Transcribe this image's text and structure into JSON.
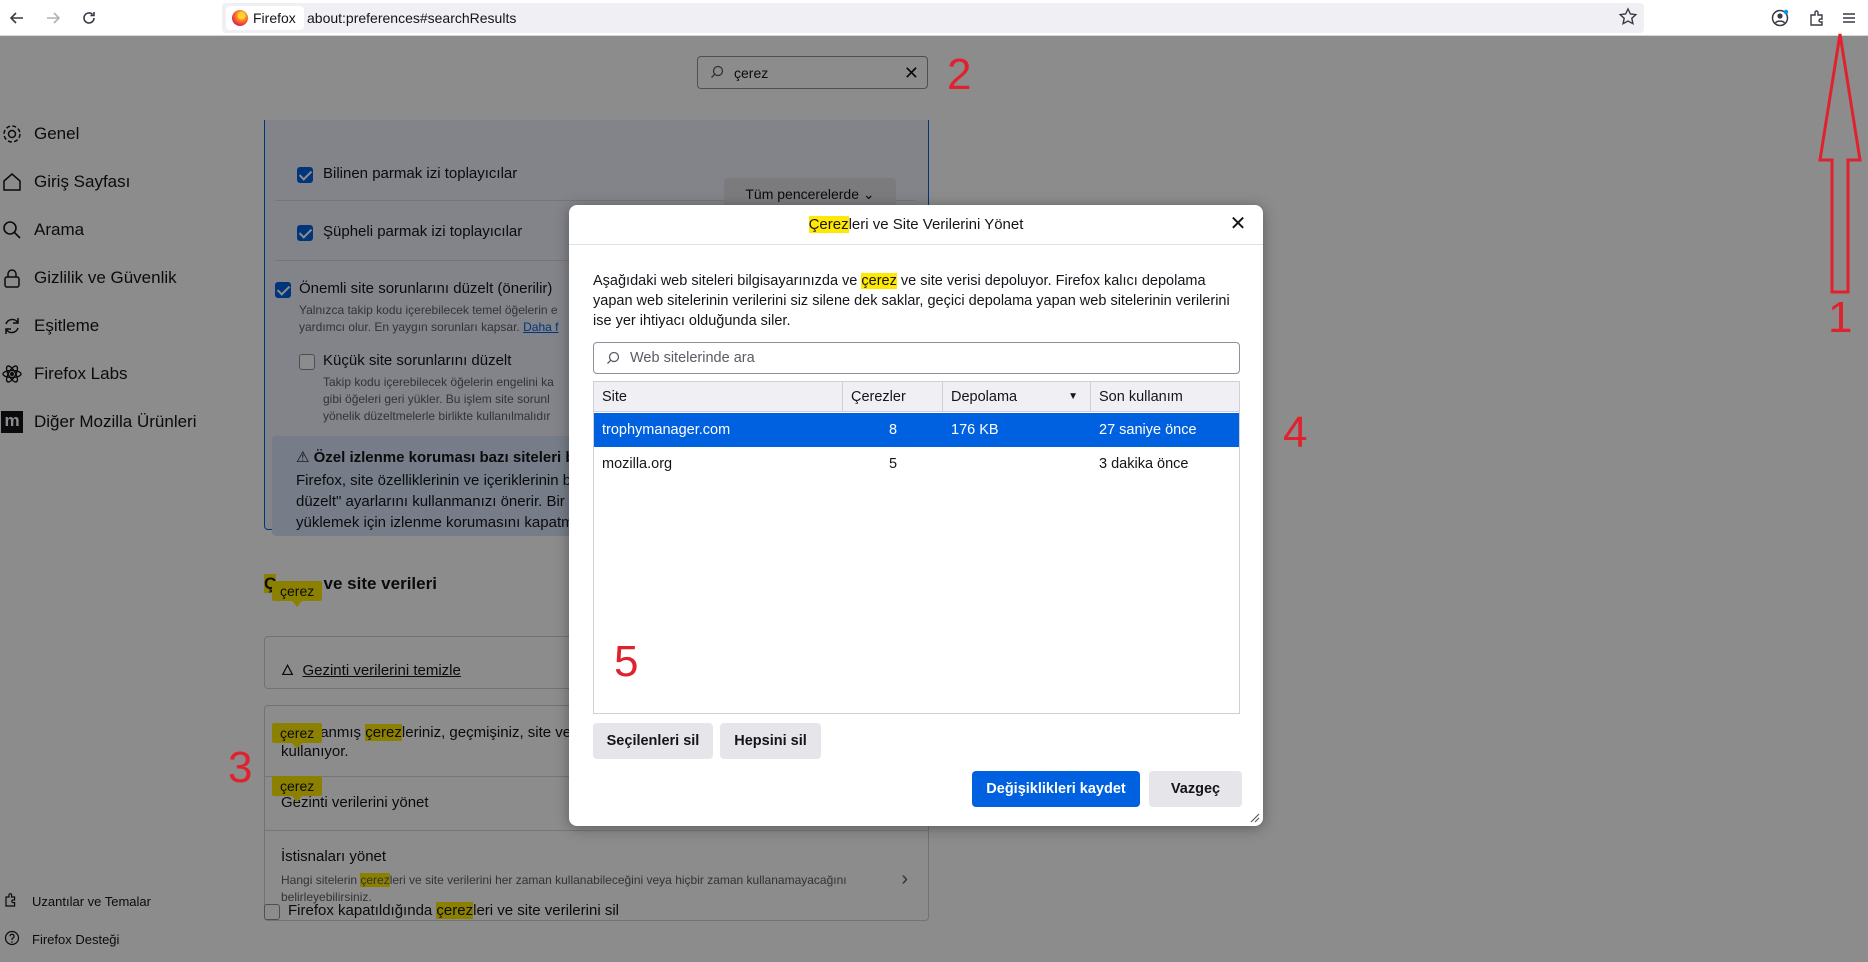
{
  "toolbar": {
    "identity_label": "Firefox",
    "url": "about:preferences#searchResults",
    "icons": [
      "back-icon",
      "forward-icon",
      "reload-icon",
      "star-icon",
      "account-icon",
      "extensions-icon",
      "menu-icon"
    ]
  },
  "prefs_search": {
    "value": "çerez"
  },
  "sidebar": {
    "items": [
      {
        "label": "Genel",
        "icon": "gear-icon"
      },
      {
        "label": "Giriş Sayfası",
        "icon": "home-icon"
      },
      {
        "label": "Arama",
        "icon": "search-icon"
      },
      {
        "label": "Gizlilik ve Güvenlik",
        "icon": "lock-icon"
      },
      {
        "label": "Eşitleme",
        "icon": "sync-icon"
      },
      {
        "label": "Firefox Labs",
        "icon": "labs-icon"
      },
      {
        "label": "Diğer Mozilla Ürünleri",
        "icon": "mozilla-icon"
      }
    ],
    "footer": [
      {
        "label": "Uzantılar ve Temalar",
        "icon": "puzzle-icon"
      },
      {
        "label": "Firefox Desteği",
        "icon": "help-icon"
      }
    ]
  },
  "etp": {
    "fingerprinters_known": "Bilinen parmak izi toplayıcılar",
    "fingerprinters_suspect": "Şüpheli parmak izi toplayıcılar",
    "all_windows_button": "Tüm pencerelerde",
    "fix_major": "Önemli site sorunlarını düzelt (önerilir)",
    "fix_major_desc_1": "Yalnızca takip kodu içerebilecek temel öğelerin e",
    "fix_major_desc_2": "yardımcı olur. En yaygın sorunları kapsar.",
    "learn_more": "Daha f",
    "fix_minor": "Küçük site sorunlarını düzelt",
    "fix_minor_desc_1": "Takip kodu içerebilecek öğelerin engelini ka",
    "fix_minor_desc_2": "gibi öğeleri geri yükler. Bu işlem site sorunl",
    "fix_minor_desc_3": "yönelik düzeltmelerle birlikte kullanılmalıdır",
    "warn_title": "Özel izlenme koruması bazı siteleri b",
    "warn_line_1": "Firefox, site özelliklerinin ve içeriklerinin b",
    "warn_line_2": "düzelt\" ayarlarını kullanmanızı önerir. Bir s",
    "warn_line_3": "yüklemek için izlenme korumasını kapatm"
  },
  "cookies_section": {
    "heading_end": "ve site verileri",
    "clear_data": "Gezinti verilerini temizle",
    "stored_1_pre": "Depolanmış ",
    "stored_1_hl": "çerez",
    "stored_1_post": "leriniz, geçmişiniz, site veri",
    "stored_2": "kullanıyor.",
    "manage_data": "Gezinti verilerini yönet",
    "manage_exceptions": "İstisnaları yönet",
    "exceptions_desc_pre": "Hangi sitelerin ",
    "exceptions_desc_hl": "çerez",
    "exceptions_desc_post": "leri ve site verilerini her zaman kullanabileceğini veya hiçbir zaman kullanamayacağını",
    "exceptions_desc_2": "belirleyebilirsiniz.",
    "delete_on_close_pre": "Firefox kapatıldığında ",
    "delete_on_close_hl": "çerez",
    "delete_on_close_post": "leri ve site verilerini sil",
    "tooltip": "çerez"
  },
  "annotations": [
    "1",
    "2",
    "3",
    "4",
    "5"
  ],
  "dialog": {
    "title_hl": "Çerez",
    "title_rest": "leri ve Site Verilerini Yönet",
    "desc_pre": "Aşağıdaki web siteleri bilgisayarınızda ve ",
    "desc_hl": "çerez",
    "desc_post": " ve site verisi depoluyor. Firefox kalıcı depolama yapan web sitelerinin verilerini siz silene dek saklar, geçici depolama yapan web sitelerinin verilerini ise yer ihtiyacı olduğunda siler.",
    "search_placeholder": "Web sitelerinde ara",
    "columns": [
      "Site",
      "Çerezler",
      "Depolama",
      "Son kullanım"
    ],
    "rows": [
      {
        "site": "trophymanager.com",
        "cookies": "8",
        "storage": "176 KB",
        "last_used": "27 saniye önce",
        "selected": true
      },
      {
        "site": "mozilla.org",
        "cookies": "5",
        "storage": "",
        "last_used": "3 dakika önce",
        "selected": false
      }
    ],
    "remove_selected": "Seçilenleri sil",
    "remove_all": "Hepsini sil",
    "save": "Değişiklikleri kaydet",
    "cancel": "Vazgeç"
  },
  "colors": {
    "accent": "#0061e0",
    "highlight": "#ffe900",
    "annotation_red": "#e0222e"
  }
}
